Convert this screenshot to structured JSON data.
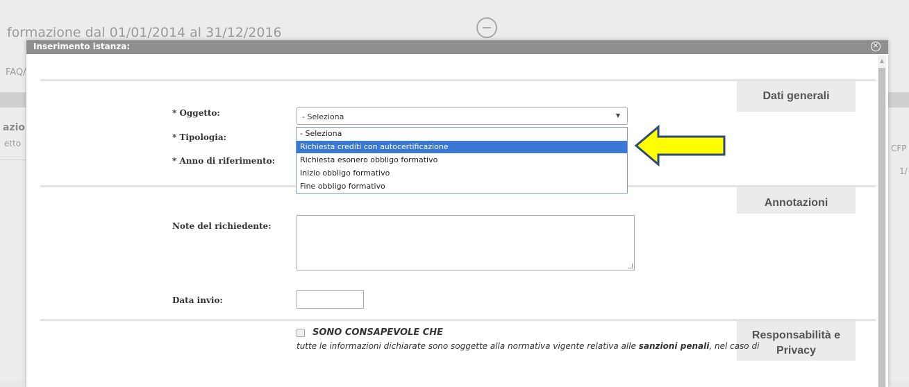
{
  "background": {
    "title": "formazione dal 01/01/2014 al 31/12/2016",
    "faq": "FAQ/",
    "left_col_1": "azio",
    "left_col_2": "etto",
    "right_col_1": "CFP",
    "right_col_2": "1/"
  },
  "modal": {
    "title": "Inserimento istanza:",
    "close_icon": "close-circle-icon",
    "sections": {
      "general": "Dati generali",
      "notes": "Annotazioni",
      "privacy_line1": "Responsabilità e",
      "privacy_line2": "Privacy"
    },
    "fields": {
      "oggetto_label": "* Oggetto:",
      "tipologia_label": "* Tipologia:",
      "anno_label": "* Anno di riferimento:",
      "note_label": "Note del richiedente:",
      "data_label": "Data invio:"
    },
    "select": {
      "value": "- Seleziona",
      "options": [
        "- Seleziona",
        "Richiesta crediti con autocertificazione",
        "Richiesta esonero obbligo formativo",
        "Inizio obbligo formativo",
        "Fine obbligo formativo"
      ],
      "highlighted_index": 1
    },
    "consent": {
      "title": "SONO CONSAPEVOLE CHE",
      "text_pre": "tutte le informazioni dichiarate sono soggette alla normativa vigente relativa alle ",
      "text_bold": "sanzioni penali",
      "text_post": ", nel caso di"
    }
  },
  "colors": {
    "arrow_fill": "#ffff00",
    "arrow_stroke": "#2f4a7a",
    "highlight": "#3a78d6",
    "header": "#8f8f8f"
  }
}
